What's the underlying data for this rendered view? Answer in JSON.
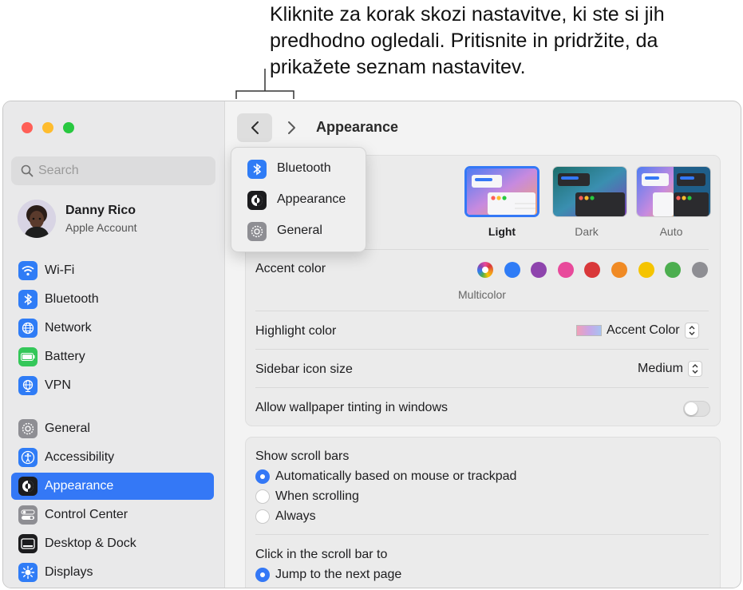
{
  "callout": {
    "line1": "Kliknite za korak skozi nastavitve, ki ste si jih",
    "line2": "predhodno ogledali. Pritisnite in pridržite, da",
    "line3": "prikažete seznam nastavitev."
  },
  "sidebar": {
    "search_placeholder": "Search",
    "account": {
      "name": "Danny Rico",
      "subtitle": "Apple Account"
    },
    "items": [
      {
        "label": "Wi-Fi",
        "icon": "wifi-icon",
        "color": "#2f7cf6"
      },
      {
        "label": "Bluetooth",
        "icon": "bluetooth-icon",
        "color": "#2f7cf6"
      },
      {
        "label": "Network",
        "icon": "globe-icon",
        "color": "#2f7cf6"
      },
      {
        "label": "Battery",
        "icon": "battery-icon",
        "color": "#34c759"
      },
      {
        "label": "VPN",
        "icon": "vpn-globe-icon",
        "color": "#2f7cf6"
      },
      {
        "label": "General",
        "icon": "gear-icon",
        "color": "#8e8e93"
      },
      {
        "label": "Accessibility",
        "icon": "accessibility-icon",
        "color": "#2f7cf6"
      },
      {
        "label": "Appearance",
        "icon": "appearance-icon",
        "color": "#1c1c1e",
        "selected": true
      },
      {
        "label": "Control Center",
        "icon": "control-center-icon",
        "color": "#8e8e93"
      },
      {
        "label": "Desktop & Dock",
        "icon": "dock-icon",
        "color": "#1c1c1e"
      },
      {
        "label": "Displays",
        "icon": "sun-icon",
        "color": "#2f7cf6"
      }
    ]
  },
  "toolbar": {
    "title": "Appearance"
  },
  "history_menu": {
    "items": [
      {
        "label": "Bluetooth",
        "icon": "bluetooth-icon"
      },
      {
        "label": "Appearance",
        "icon": "appearance-icon"
      },
      {
        "label": "General",
        "icon": "gear-icon"
      }
    ]
  },
  "appearance": {
    "themes": [
      {
        "label": "Light",
        "selected": true
      },
      {
        "label": "Dark",
        "selected": false
      },
      {
        "label": "Auto",
        "selected": false
      }
    ],
    "accent_color_label": "Accent color",
    "accent_selected_caption": "Multicolor",
    "accent_colors": [
      "multicolor",
      "#2f7cf6",
      "#8e44ad",
      "#e84a9b",
      "#d9383a",
      "#f08a24",
      "#f5c400",
      "#4cae4f",
      "#8e8e93"
    ],
    "highlight_color_label": "Highlight color",
    "highlight_color_value": "Accent Color",
    "sidebar_icon_size_label": "Sidebar icon size",
    "sidebar_icon_size_value": "Medium",
    "wallpaper_tinting_label": "Allow wallpaper tinting in windows",
    "wallpaper_tinting_on": false
  },
  "scroll": {
    "show_label": "Show scroll bars",
    "show_options": [
      {
        "label": "Automatically based on mouse or trackpad",
        "selected": true
      },
      {
        "label": "When scrolling",
        "selected": false
      },
      {
        "label": "Always",
        "selected": false
      }
    ],
    "click_label": "Click in the scroll bar to",
    "click_options": [
      {
        "label": "Jump to the next page",
        "selected": true
      }
    ]
  }
}
